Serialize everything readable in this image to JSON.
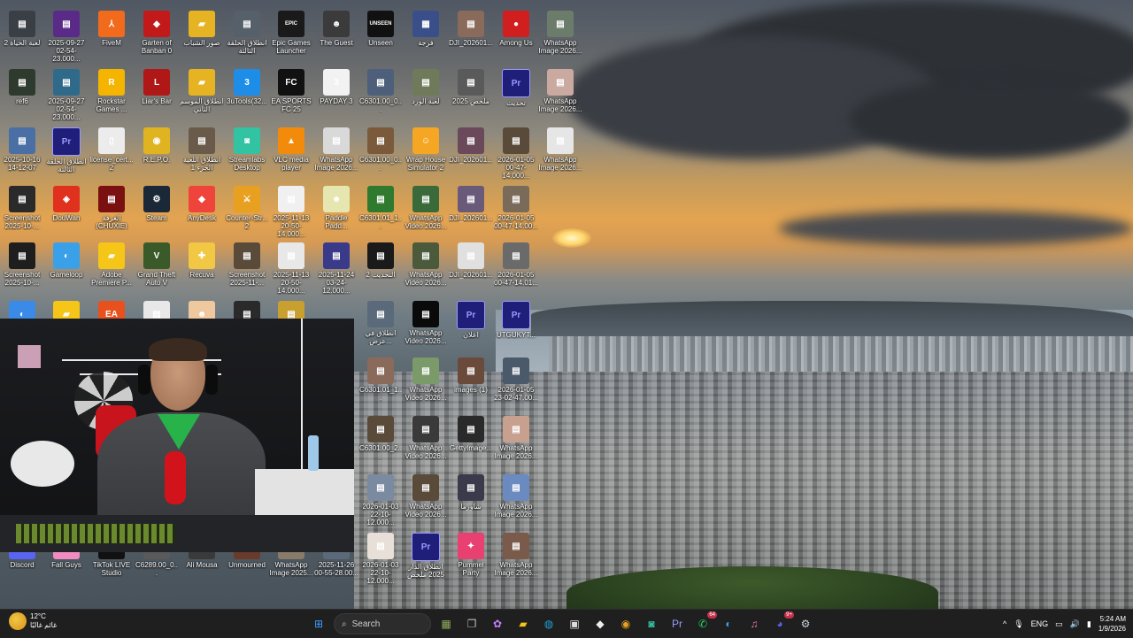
{
  "desktop": {
    "icons": [
      {
        "label": "لعبة الحياة 2",
        "color": "#3a3f46",
        "glyph": "▤"
      },
      {
        "label": "2025-09-27 02-54-23.000...",
        "color": "#5a2a88",
        "glyph": "▤"
      },
      {
        "label": "FiveM",
        "color": "#f26a1b",
        "glyph": "⅄"
      },
      {
        "label": "Garten of Banban 0",
        "color": "#c21a1a",
        "glyph": "◆"
      },
      {
        "label": "صور الشباب",
        "color": "#e6b422",
        "glyph": "▰"
      },
      {
        "label": "انطلاق الحلقة الثالثة",
        "color": "#55606a",
        "glyph": "▤"
      },
      {
        "label": "Epic Games Launcher",
        "color": "#1a1a1a",
        "glyph": "EPIC"
      },
      {
        "label": "The Guest",
        "color": "#3b3b3b",
        "glyph": "☻"
      },
      {
        "label": "Unseen",
        "color": "#111111",
        "glyph": "UNSEEN"
      },
      {
        "label": "فرجة",
        "color": "#3a4f8a",
        "glyph": "▦"
      },
      {
        "label": "DJI_202601...",
        "color": "#8a6a5a",
        "glyph": "▤"
      },
      {
        "label": "Among Us",
        "color": "#d11f1f",
        "glyph": "●"
      },
      {
        "label": "WhatsApp Image 2026...",
        "color": "#6b7d6a",
        "glyph": "▤"
      },
      {
        "label": "ref6",
        "color": "#2f3a2f",
        "glyph": "▤"
      },
      {
        "label": "2025-09-27 02-54-23.000...",
        "color": "#2f6a8a",
        "glyph": "▤"
      },
      {
        "label": "Rockstar Games ...",
        "color": "#f4b400",
        "glyph": "R"
      },
      {
        "label": "Liar's Bar",
        "color": "#b01818",
        "glyph": "L"
      },
      {
        "label": "انطلاق الموسم الثاني",
        "color": "#e6b422",
        "glyph": "▰"
      },
      {
        "label": "3uTools(32...",
        "color": "#1d8de8",
        "glyph": "3"
      },
      {
        "label": "EA SPORTS FC 25",
        "color": "#111",
        "glyph": "FC"
      },
      {
        "label": "PAYDAY 3",
        "color": "#f2f2f2",
        "glyph": "3"
      },
      {
        "label": "C6301.00_0...",
        "color": "#4d5f7a",
        "glyph": "▤"
      },
      {
        "label": "لعبة الورد",
        "color": "#6f7a5a",
        "glyph": "▤"
      },
      {
        "label": "ملخص 2025",
        "color": "#5a5a5a",
        "glyph": "▤"
      },
      {
        "label": "تحديث",
        "color": "#1f1f7a",
        "glyph": "Pr"
      },
      {
        "label": "WhatsApp Image 2026...",
        "color": "#c9a9a0",
        "glyph": "▤"
      },
      {
        "label": "2025-10-16 14-12-07",
        "color": "#4a6fa5",
        "glyph": "▤"
      },
      {
        "label": "انطلاق الحلقة الثالثة",
        "color": "#1f1f7a",
        "glyph": "Pr"
      },
      {
        "label": "license_cert... 2",
        "color": "#ececec",
        "glyph": "▯"
      },
      {
        "label": "R.E.P.O.",
        "color": "#e0b420",
        "glyph": "◉"
      },
      {
        "label": "انطلاق اللعبة الجزء 1",
        "color": "#6a5a4a",
        "glyph": "▤"
      },
      {
        "label": "Streamlabs Desktop",
        "color": "#31c3a2",
        "glyph": "◙"
      },
      {
        "label": "VLC media player",
        "color": "#f28b0c",
        "glyph": "▲"
      },
      {
        "label": "WhatsApp Image 2026...",
        "color": "#d9d9d9",
        "glyph": "▤"
      },
      {
        "label": "C6301.00_0...",
        "color": "#7a5a3a",
        "glyph": "▤"
      },
      {
        "label": "Wrap House Simulator 2",
        "color": "#f5a623",
        "glyph": "☺"
      },
      {
        "label": "DJI_202601...",
        "color": "#6a4a5a",
        "glyph": "▤"
      },
      {
        "label": "2026-01-05 00-47-14.000...",
        "color": "#5a4a3a",
        "glyph": "▤"
      },
      {
        "label": "WhatsApp Image 2026...",
        "color": "#e6e6e6",
        "glyph": "▤"
      },
      {
        "label": "Screenshot 2025-10-...",
        "color": "#2a2a2a",
        "glyph": "▤"
      },
      {
        "label": "DouWan",
        "color": "#e0301e",
        "glyph": "◈"
      },
      {
        "label": "الغرفة (CHUXIE)",
        "color": "#7a1010",
        "glyph": "▤"
      },
      {
        "label": "Steam",
        "color": "#1b2838",
        "glyph": "⚙"
      },
      {
        "label": "AnyDesk",
        "color": "#ef443b",
        "glyph": "◆"
      },
      {
        "label": "Counter-Str... 2",
        "color": "#e8a020",
        "glyph": "⚔"
      },
      {
        "label": "2025-11-13 20-50-14.000...",
        "color": "#f0f0f0",
        "glyph": "▤"
      },
      {
        "label": "Paddle Padd...",
        "color": "#e6e6b0",
        "glyph": "☻"
      },
      {
        "label": "C6301.01_1...",
        "color": "#2f7a2f",
        "glyph": "▤"
      },
      {
        "label": "WhatsApp Video 2026...",
        "color": "#3a6a3a",
        "glyph": "▤"
      },
      {
        "label": "DJI_202601...",
        "color": "#6a5a7a",
        "glyph": "▤"
      },
      {
        "label": "2026-01-05 00-47-14.00...",
        "color": "#7a6a5a",
        "glyph": "▤"
      },
      {
        "label": "Screenshot 2025-10-...",
        "color": "#1e1e1e",
        "glyph": "▤"
      },
      {
        "label": "Gameloop",
        "color": "#3aa0e8",
        "glyph": "◐"
      },
      {
        "label": "Adobe Premiere P...",
        "color": "#f5c518",
        "glyph": "▰"
      },
      {
        "label": "Grand Theft Auto V",
        "color": "#3a5a2a",
        "glyph": "V"
      },
      {
        "label": "Recuva",
        "color": "#f2c744",
        "glyph": "✚"
      },
      {
        "label": "Screenshot 2025-11-...",
        "color": "#5a4a3a",
        "glyph": "▤"
      },
      {
        "label": "2025-11-13 20-50-14.000...",
        "color": "#e8e8e8",
        "glyph": "▤"
      },
      {
        "label": "2025-11-24 03-24-12.000...",
        "color": "#3a3a8a",
        "glyph": "▤"
      },
      {
        "label": "التحديث 2",
        "color": "#1a1a1a",
        "glyph": "▤"
      },
      {
        "label": "WhatsApp Video 2026...",
        "color": "#4a5a3a",
        "glyph": "▤"
      },
      {
        "label": "DJI_202601...",
        "color": "#e0e0e0",
        "glyph": "▤"
      },
      {
        "label": "2026-01-05 00-47-14.01...",
        "color": "#6a6a6a",
        "glyph": "▤"
      },
      {
        "label": "",
        "color": "#3a8ae8",
        "glyph": "◐"
      },
      {
        "label": "",
        "color": "#f5c518",
        "glyph": "▰"
      },
      {
        "label": "",
        "color": "#e8501e",
        "glyph": "EA"
      },
      {
        "label": "",
        "color": "#e8e8e8",
        "glyph": "▤"
      },
      {
        "label": "",
        "color": "#f0c8a0",
        "glyph": "☻"
      },
      {
        "label": "",
        "color": "#2a2a2a",
        "glyph": "▤"
      },
      {
        "label": "",
        "color": "#c8a030",
        "glyph": "▤"
      },
      {
        "label": "انطلاق في عرض...",
        "color": "#5a6a7a",
        "glyph": "▤"
      },
      {
        "label": "WhatsApp Video 2026...",
        "color": "#0a0a0a",
        "glyph": "▤"
      },
      {
        "label": "اعلان",
        "color": "#1f1f7a",
        "glyph": "Pr"
      },
      {
        "label": "UTGUKYT...",
        "color": "#1f1f7a",
        "glyph": "Pr"
      },
      {
        "label": "C6301.01_1...",
        "color": "#8a6a5a",
        "glyph": "▤"
      },
      {
        "label": "WhatsApp Video 2026...",
        "color": "#7a9a6a",
        "glyph": "▤"
      },
      {
        "label": "images (1)",
        "color": "#6a4a3a",
        "glyph": "▤"
      },
      {
        "label": "2026-01-05 23-02-47.00...",
        "color": "#4a5a6a",
        "glyph": "▤"
      },
      {
        "label": "C6301.00_2...",
        "color": "#5a4a3a",
        "glyph": "▤"
      },
      {
        "label": "WhatsApp Video 2026...",
        "color": "#3a3a3a",
        "glyph": "▤"
      },
      {
        "label": "GettyImage...",
        "color": "#2a2a2a",
        "glyph": "▤"
      },
      {
        "label": "WhatsApp Image 2026...",
        "color": "#c8a090",
        "glyph": "▤"
      },
      {
        "label": "2026-01-03 22-10-12.000...",
        "color": "#7a8aa0",
        "glyph": "▤"
      },
      {
        "label": "WhatsApp Video 2026...",
        "color": "#5a4a3a",
        "glyph": "▤"
      },
      {
        "label": "شاورما",
        "color": "#3a3a4a",
        "glyph": "▤"
      },
      {
        "label": "WhatsApp Image 2026...",
        "color": "#6a8ac0",
        "glyph": "▤"
      },
      {
        "label": "Discord",
        "color": "#5865f2",
        "glyph": "◕"
      },
      {
        "label": "Fall Guys",
        "color": "#f08cc0",
        "glyph": "☻"
      },
      {
        "label": "TikTok LIVE Studio",
        "color": "#111",
        "glyph": "♪"
      },
      {
        "label": "C6289.00_0...",
        "color": "#5a5a5a",
        "glyph": "▤"
      },
      {
        "label": "Ali Mousa",
        "color": "#3a3a3a",
        "glyph": "▤"
      },
      {
        "label": "Unmourned",
        "color": "#6a3a2a",
        "glyph": "▤"
      },
      {
        "label": "WhatsApp Image 2025...",
        "color": "#8a7a6a",
        "glyph": "▤"
      },
      {
        "label": "2025-11-26 00-55-28.00...",
        "color": "#5a6a7a",
        "glyph": "▤"
      },
      {
        "label": "2026-01-03 22-10-12.000...",
        "color": "#e8e0d8",
        "glyph": "▤"
      },
      {
        "label": "انطلاق الدار 2025 ملخص",
        "color": "#1f1f7a",
        "glyph": "Pr"
      },
      {
        "label": "Pummel Party",
        "color": "#e84070",
        "glyph": "✦"
      },
      {
        "label": "WhatsApp Image 2026...",
        "color": "#7a5a4a",
        "glyph": "▤"
      }
    ]
  },
  "taskbar": {
    "weather": {
      "temp": "12°C",
      "condition": "غائم غالبًا"
    },
    "search_label": "Search",
    "apps": [
      {
        "name": "start-button",
        "glyph": "⊞",
        "color": "#3aa0ff"
      },
      {
        "name": "thumb",
        "glyph": "▦",
        "color": "#8fae5a"
      },
      {
        "name": "task-view",
        "glyph": "❐",
        "color": "#bbbbbb"
      },
      {
        "name": "copilot",
        "glyph": "✿",
        "color": "#c080ff"
      },
      {
        "name": "file-explorer",
        "glyph": "▰",
        "color": "#f5c518"
      },
      {
        "name": "edge",
        "glyph": "◍",
        "color": "#1fa0d8"
      },
      {
        "name": "store",
        "glyph": "▣",
        "color": "#dddddd"
      },
      {
        "name": "pin-app",
        "glyph": "◆",
        "color": "#eeeeee"
      },
      {
        "name": "chrome",
        "glyph": "◉",
        "color": "#e8a020"
      },
      {
        "name": "streamlabs",
        "glyph": "◙",
        "color": "#31c3a2"
      },
      {
        "name": "premiere",
        "glyph": "Pr",
        "color": "#9999ff"
      },
      {
        "name": "whatsapp",
        "glyph": "✆",
        "color": "#25d366",
        "badge": "64"
      },
      {
        "name": "gameloop",
        "glyph": "◐",
        "color": "#3aa0e8"
      },
      {
        "name": "itunes",
        "glyph": "♫",
        "color": "#f070b0"
      },
      {
        "name": "discord",
        "glyph": "◕",
        "color": "#5865f2",
        "badge": "9+"
      },
      {
        "name": "steam",
        "glyph": "⚙",
        "color": "#c7d5e0"
      }
    ],
    "tray": {
      "chevron": "^",
      "mic": "🎙",
      "lang": "ENG",
      "time": "5:24 AM",
      "date": "1/9/2026"
    }
  }
}
